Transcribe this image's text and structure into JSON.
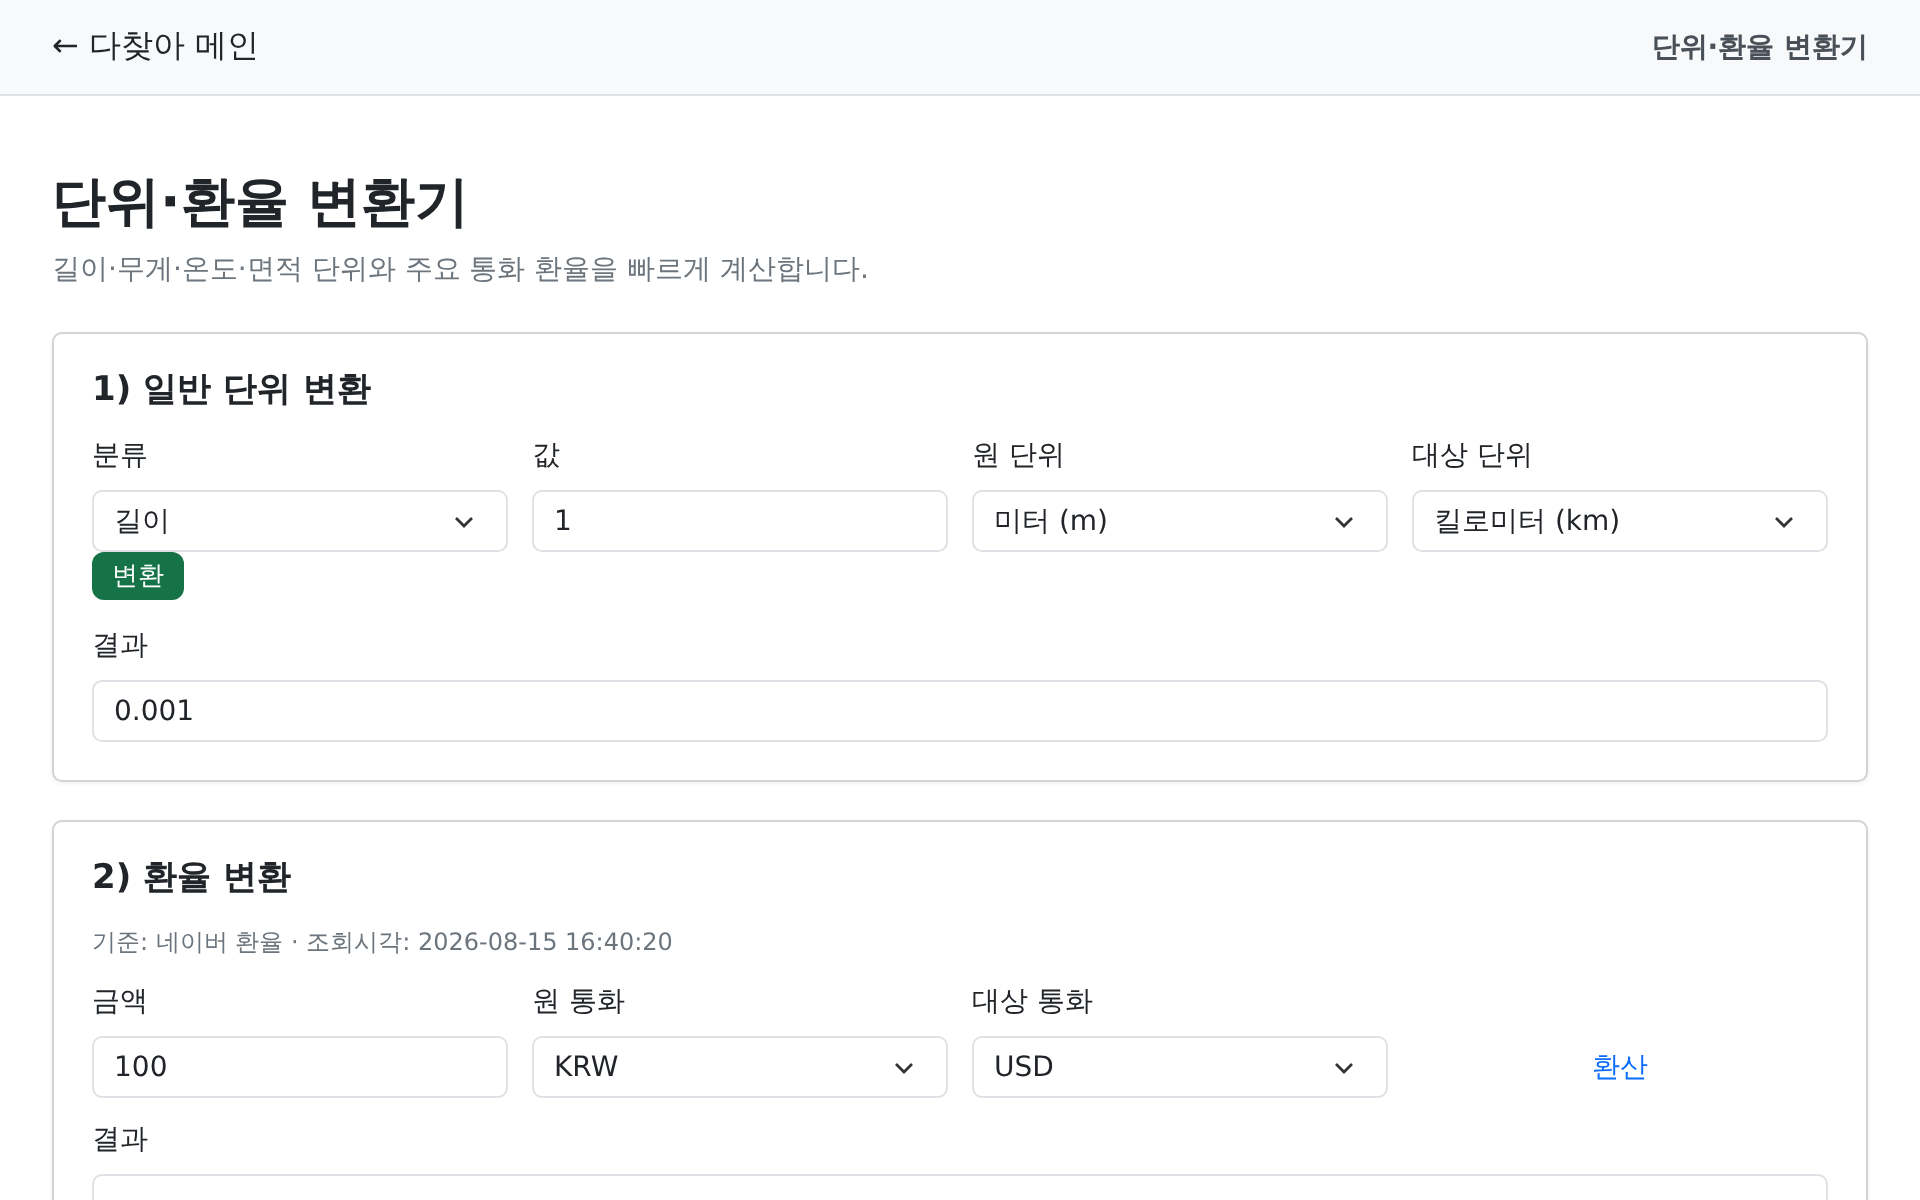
{
  "header": {
    "back_link": "← 다찾아 메인",
    "page_name": "단위·환율 변환기"
  },
  "title": "단위·환율 변환기",
  "subtitle": "길이·무게·온도·면적 단위와 주요 통화 환율을 빠르게 계산합니다.",
  "unit_card": {
    "title": "1) 일반 단위 변환",
    "fields": [
      {
        "kind": "select",
        "label": "분류",
        "value": "길이"
      },
      {
        "kind": "input",
        "label": "값",
        "value": "1"
      },
      {
        "kind": "select",
        "label": "원 단위",
        "value": "미터 (m)"
      },
      {
        "kind": "select",
        "label": "대상 단위",
        "value": "킬로미터 (km)"
      }
    ],
    "button": "변환",
    "result_label": "결과",
    "result": "0.001"
  },
  "currency_card": {
    "title": "2) 환율 변환",
    "note": "기준: 네이버 환율 · 조회시각: 2026-08-15 16:40:20",
    "fields": [
      {
        "kind": "input",
        "label": "금액",
        "value": "100"
      },
      {
        "kind": "select",
        "label": "원 통화",
        "value": "KRW"
      },
      {
        "kind": "select",
        "label": "대상 통화",
        "value": "USD"
      }
    ],
    "button": "환산",
    "result_label": "결과"
  }
}
